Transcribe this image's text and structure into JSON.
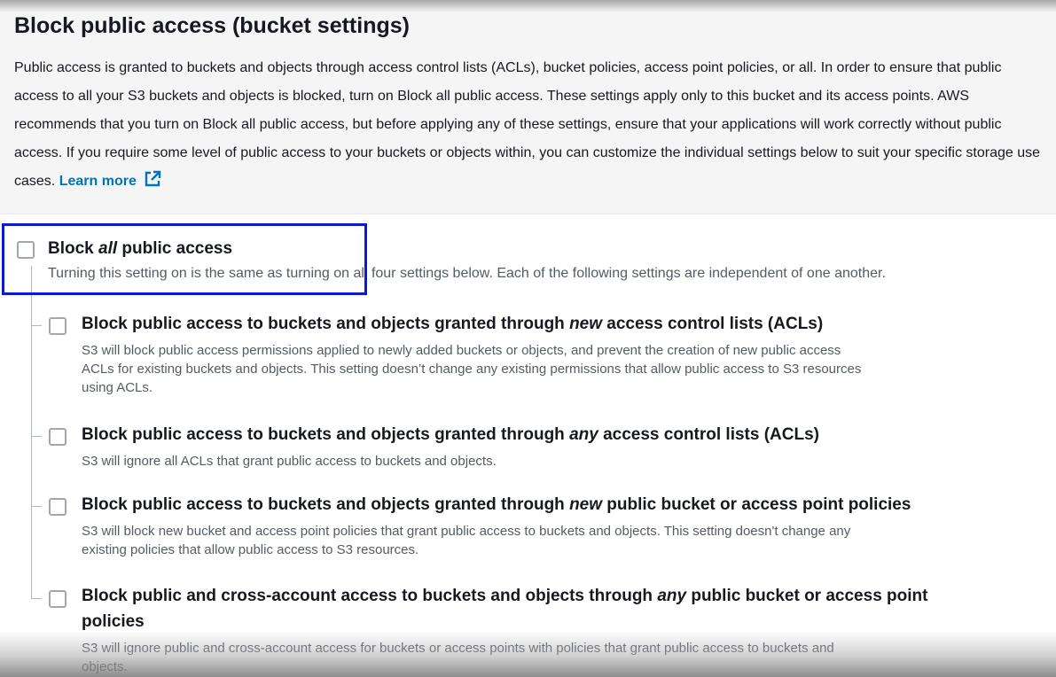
{
  "page": {
    "title": "Block public access (bucket settings)",
    "intro_text": "Public access is granted to buckets and objects through access control lists (ACLs), bucket policies, access point policies, or all. In order to ensure that public access to all your S3 buckets and objects is blocked, turn on Block all public access. These settings apply only to this bucket and its access points. AWS recommends that you turn on Block all public access, but before applying any of these settings, ensure that your applications will work correctly without public access. If you require some level of public access to your buckets or objects within, you can customize the individual settings below to suit your specific storage use cases.",
    "learn_more_label": "Learn more",
    "learn_more_icon": "external-link-icon"
  },
  "master_option": {
    "title_prefix": "Block ",
    "title_emphasis": "all",
    "title_suffix": " public access",
    "description": "Turning this setting on is the same as turning on all four settings below. Each of the following settings are independent of one another.",
    "checked": false
  },
  "sub_options": [
    {
      "title_prefix": "Block public access to buckets and objects granted through ",
      "title_emphasis": "new",
      "title_suffix": " access control lists (ACLs)",
      "description_lines": [
        "S3 will block public access permissions applied to newly added buckets or objects, and prevent the creation of new public access",
        "ACLs for existing buckets and objects. This setting doesn’t change any existing permissions that allow public access to S3 resources",
        "using ACLs."
      ],
      "checked": false
    },
    {
      "title_prefix": "Block public access to buckets and objects granted through ",
      "title_emphasis": "any",
      "title_suffix": " access control lists (ACLs)",
      "description_lines": [
        "S3 will ignore all ACLs that grant public access to buckets and objects."
      ],
      "checked": false
    },
    {
      "title_prefix": "Block public access to buckets and objects granted through ",
      "title_emphasis": "new",
      "title_suffix": " public bucket or access point policies",
      "description_lines": [
        "S3 will block new bucket and access point policies that grant public access to buckets and objects. This setting doesn't change any",
        "existing policies that allow public access to S3 resources."
      ],
      "checked": false
    },
    {
      "title_prefix": "Block public and cross-account access to buckets and objects through ",
      "title_emphasis": "any",
      "title_suffix": " public bucket or access point",
      "title_line2": "policies",
      "description_lines": [
        "S3 will ignore public and cross-account access for buckets or access points with policies that grant public access to buckets and",
        "objects."
      ],
      "checked": false
    }
  ],
  "colors": {
    "link": "#0073bb",
    "highlight_box": "#0a1bd6",
    "heading": "#16191f",
    "description": "#545b64"
  }
}
